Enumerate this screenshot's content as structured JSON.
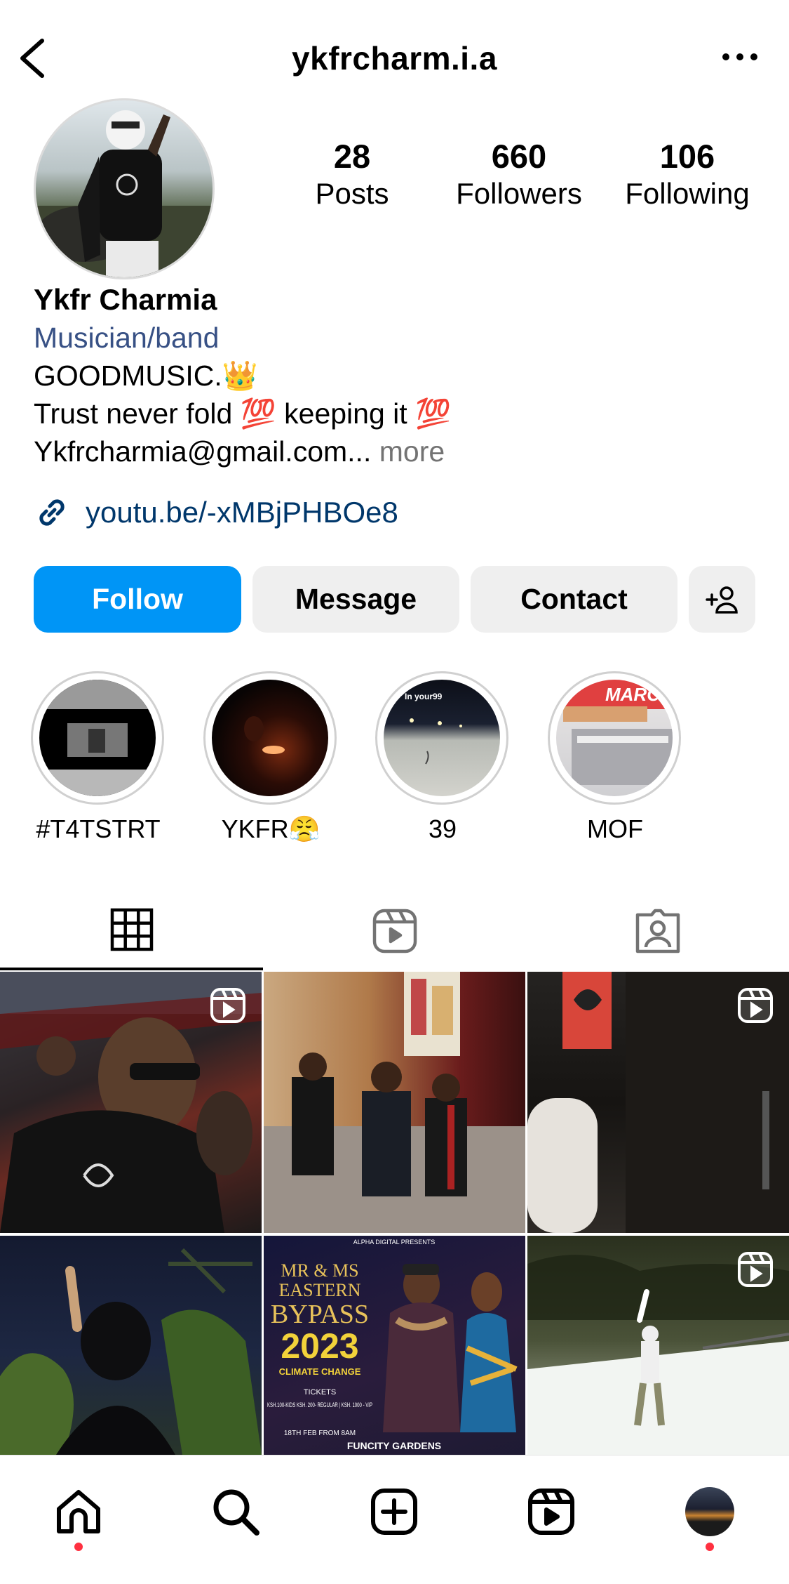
{
  "header": {
    "username": "ykfrcharm.i.a"
  },
  "stats": [
    {
      "value": "28",
      "label": "Posts"
    },
    {
      "value": "660",
      "label": "Followers"
    },
    {
      "value": "106",
      "label": "Following"
    }
  ],
  "bio": {
    "name": "Ykfr Charmia",
    "category": "Musician/band",
    "line1": "GOODMUSIC.👑",
    "line2": "Trust never fold 💯 keeping it 💯",
    "line3": "Ykfrcharmia@gmail.com...",
    "more": "more",
    "link": "youtu.be/-xMBjPHBOe8"
  },
  "buttons": {
    "follow": "Follow",
    "message": "Message",
    "contact": "Contact"
  },
  "highlights": [
    {
      "label": "#T4TSTRT"
    },
    {
      "label": "YKFR😤"
    },
    {
      "label": "39",
      "overlay_text": "In your99"
    },
    {
      "label": "MOF",
      "overlay_text": "MARC"
    }
  ],
  "grid": {
    "poster": {
      "top_line": "ALPHA DIGITAL PRESENTS",
      "title_line1": "MR & MS",
      "title_line2": "EASTERN",
      "title_line3": "BYPASS",
      "year": "2023",
      "tagline": "CLIMATE CHANGE",
      "tickets": "TICKETS",
      "prices": "KSH.100-KIDS KSH. 200- REGULAR | KSH. 1000 - VIP",
      "date": "18TH FEB FROM 8AM",
      "venue": "FUNCITY GARDENS"
    }
  },
  "colors": {
    "accent": "#0095f6",
    "link": "#00376b",
    "notification": "#ff3040"
  }
}
